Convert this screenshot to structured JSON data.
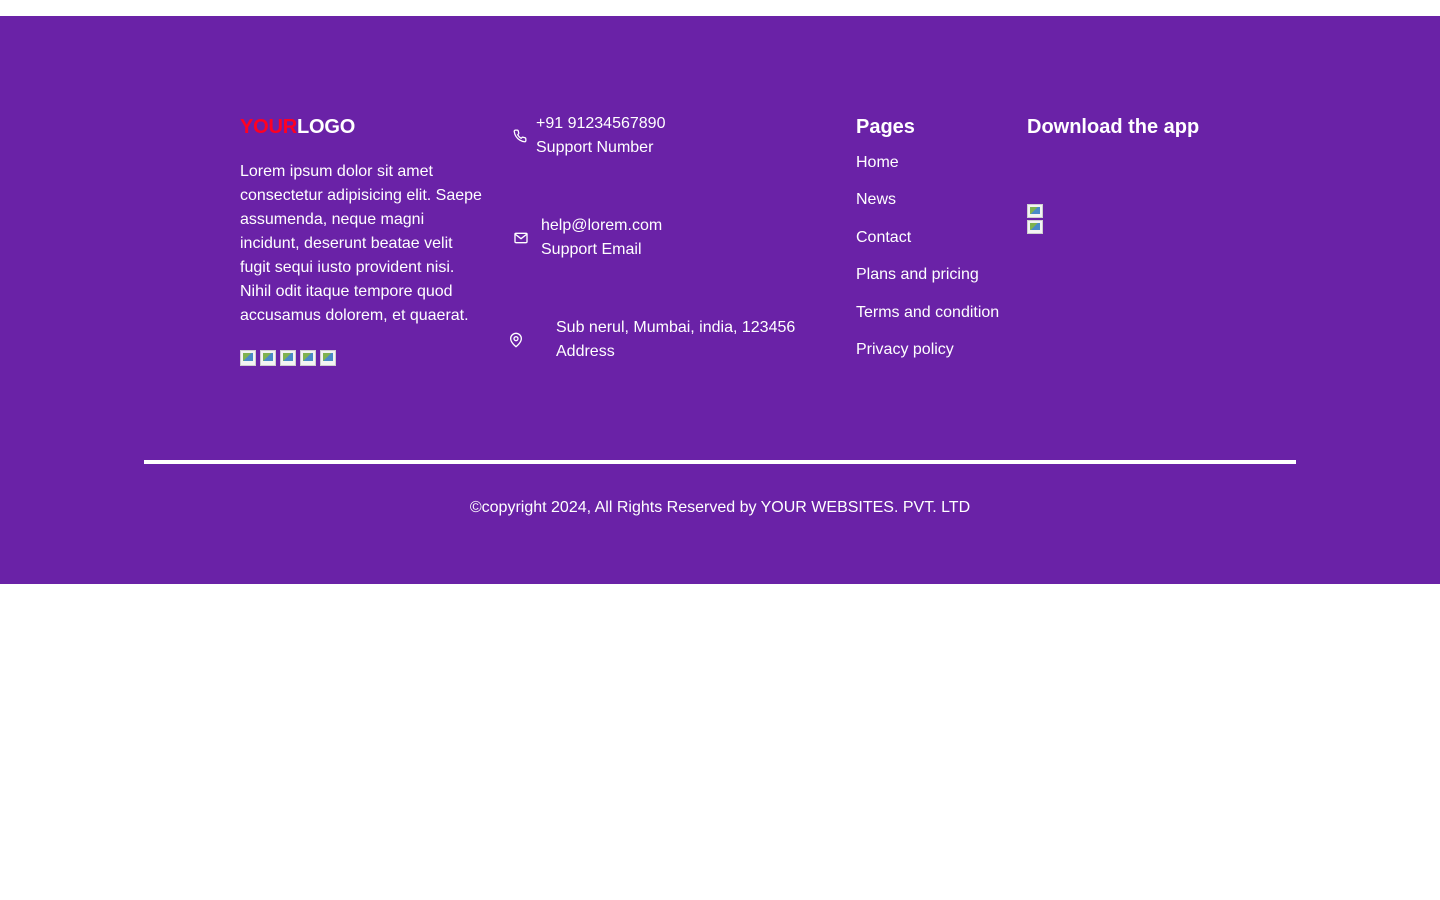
{
  "brand": {
    "logo_part1": "YOUR",
    "logo_part2": "LOGO",
    "description": "Lorem ipsum dolor sit amet consectetur adipisicing elit. Saepe assumenda, neque magni incidunt, deserunt beatae velit fugit sequi iusto provident nisi. Nihil odit itaque tempore quod accusamus dolorem, et quaerat.",
    "social_icons": [
      "facebook-icon",
      "twitter-icon",
      "instagram-icon",
      "linkedin-icon",
      "youtube-icon"
    ]
  },
  "contact": {
    "phone": {
      "value": "+91 91234567890",
      "label": "Support Number",
      "icon": "phone-icon"
    },
    "email": {
      "value": "help@lorem.com",
      "label": "Support Email",
      "icon": "mail-icon"
    },
    "address": {
      "value": "Sub nerul, Mumbai, india, 123456",
      "label": "Address",
      "icon": "map-pin-icon"
    }
  },
  "pages": {
    "title": "Pages",
    "links": [
      "Home",
      "News",
      "Contact",
      "Plans and pricing",
      "Terms and condition",
      "Privacy policy"
    ]
  },
  "app": {
    "title": "Download the app",
    "badges": [
      "app-store-badge",
      "google-play-badge"
    ]
  },
  "footer": {
    "copyright": "©copyright 2024, All Rights Reserved by YOUR WEBSITES. PVT. LTD"
  },
  "colors": {
    "footer_bg": "#6a22a7",
    "logo_accent": "#ff0022",
    "text": "#ffffff"
  }
}
